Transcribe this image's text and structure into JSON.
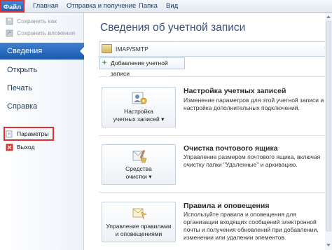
{
  "ribbon": {
    "file_tab": "Файл",
    "tabs": [
      "Главная",
      "Отправка и получение",
      "Папка",
      "Вид"
    ]
  },
  "nav": {
    "save_as": "Сохранить как",
    "save_attachments": "Сохранить вложения",
    "info": "Сведения",
    "open": "Открыть",
    "print": "Печать",
    "help": "Справка",
    "options": "Параметры",
    "exit": "Выход"
  },
  "main": {
    "title": "Сведения об учетной записи",
    "account": "IMAP/SMTP",
    "add_account": "Добавление учетной записи",
    "sections": [
      {
        "button_line1": "Настройка",
        "button_line2": "учетных записей ▾",
        "title": "Настройка учетных записей",
        "description": "Изменение параметров для этой учетной записи и настройка дополнительных подключений."
      },
      {
        "button_line1": "Средства",
        "button_line2": "очистки ▾",
        "title": "Очистка почтового ящика",
        "description": "Управление размером почтового ящика, включая очистку папки \"Удаленные\" и архивацию."
      },
      {
        "button_line1": "Управление правилами",
        "button_line2": "и оповещениями",
        "title": "Правила и оповещения",
        "description": "Используйте правила и оповещения для организации входящих сообщений электронной почты и получения обновлений при добавлении, изменении или удалении элементов."
      }
    ]
  },
  "colors": {
    "accent": "#1f5fb5",
    "highlight_frame": "#e03030"
  }
}
